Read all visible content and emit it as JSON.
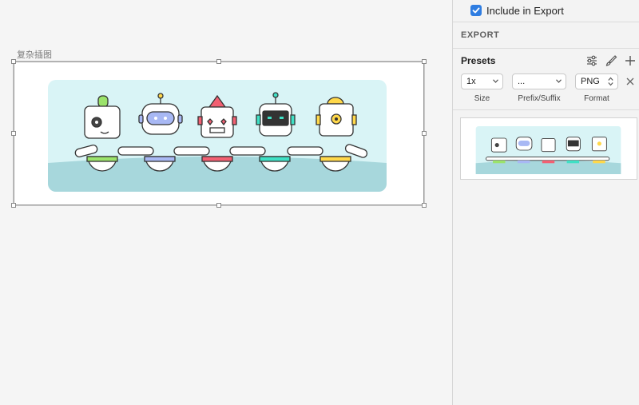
{
  "canvas": {
    "artboard_label": "复杂插图"
  },
  "inspector": {
    "include_in_export": {
      "label": "Include in Export",
      "checked": true
    },
    "export_section_title": "EXPORT",
    "presets_label": "Presets",
    "preset": {
      "size_value": "1x",
      "prefix_value": "...",
      "format_value": "PNG",
      "size_label": "Size",
      "prefix_label": "Prefix/Suffix",
      "format_label": "Format"
    },
    "icons": {
      "settings": "sliders-icon",
      "edit": "brush-icon",
      "add": "plus-icon",
      "remove": "close-icon"
    }
  },
  "colors": {
    "accent": "#2f7de1",
    "illustration_bg": "#d9f4f6",
    "illustration_ground": "#a7d7dc",
    "robot_green": "#9be36b",
    "robot_blue": "#a8b8f4",
    "robot_red": "#f26072",
    "robot_teal": "#3fe0c5",
    "robot_yellow": "#ffd84a"
  }
}
